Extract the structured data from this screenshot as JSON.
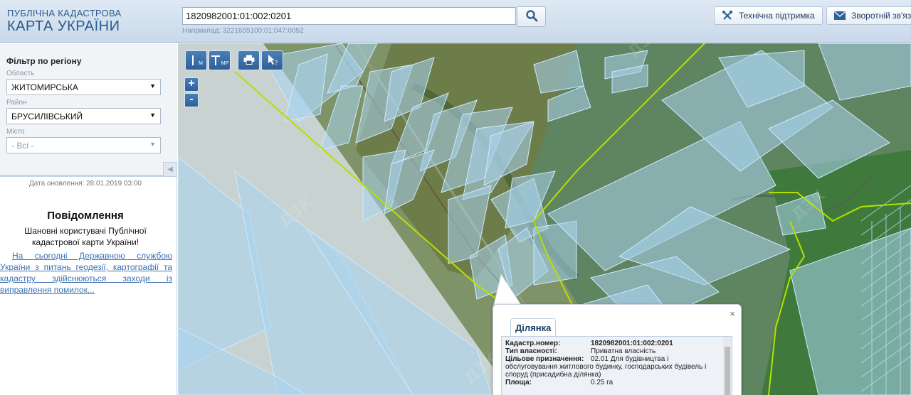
{
  "header": {
    "logo_line1": "ПУБЛІЧНА КАДАСТРОВА",
    "logo_line2": "КАРТА УКРАЇНИ",
    "search_value": "1820982001:01:002:0201",
    "search_hint": "Наприклад: 3221655100:01:047:0052",
    "support_label": "Технічна підтримка",
    "feedback_label": "Зворотній зв'язок"
  },
  "sidebar": {
    "filter_title": "Фільтр по регіону",
    "oblast_label": "Область",
    "oblast_value": "ЖИТОМИРСЬКА",
    "raion_label": "Район",
    "raion_value": "БРУСИЛІВСЬКИЙ",
    "city_label": "Місто",
    "city_value": "- Всі -",
    "update_date": "Дата оновлення: 28.01.2019 03:00",
    "notice_title": "Повідомлення",
    "notice_subtitle": "Шановні користувачі Публічної кадастрової карти України!",
    "notice_link": "На сьогодні Державною службою України з питань геодезії, картографії та кадастру здійснюються заходи із виправлення помилок..."
  },
  "map": {
    "tools": [
      "М",
      "МР"
    ],
    "zoom_in": "+",
    "zoom_out": "-",
    "watermark": "ДЗК"
  },
  "popup": {
    "tab_label": "Ділянка",
    "close": "×",
    "cadastral_key": "Кадастр.номер:",
    "cadastral_val": "1820982001:01:002:0201",
    "ownership_key": "Тип власності:",
    "ownership_val": "Приватна власність",
    "purpose_key": "Цільове призначення:",
    "purpose_val_first": "02.01 Для будівництва і",
    "purpose_val_rest": "обслуговування житлового будинку, господарських будівель і споруд (присадибна ділянка)",
    "area_key": "Площа:",
    "area_val": "0.25 га"
  },
  "colors": {
    "header_text": "#2a5a8f",
    "parcel_fill": "#a9d3ee",
    "parcel_stroke": "#cfeaff",
    "boundary": "#b6e000",
    "link": "#3b71b3"
  }
}
